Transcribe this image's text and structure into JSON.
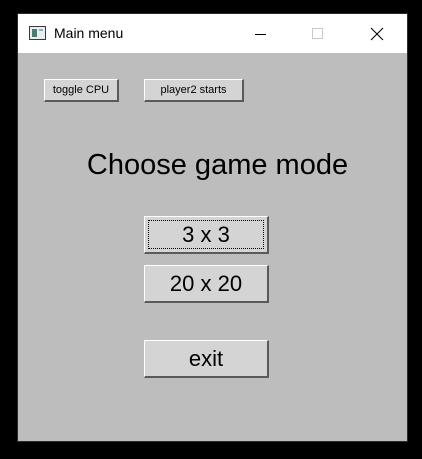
{
  "window": {
    "title": "Main menu",
    "icon": "window-app-icon",
    "controls": {
      "minimize_icon": "minimize-icon",
      "maximize_icon": "maximize-icon",
      "close_icon": "close-icon"
    }
  },
  "toolbar": {
    "toggle_cpu_label": "toggle CPU",
    "player2_starts_label": "player2 starts"
  },
  "main": {
    "heading": "Choose game mode",
    "modes": {
      "small_label": "3 x 3",
      "large_label": "20 x 20"
    },
    "exit_label": "exit"
  },
  "colors": {
    "window_background": "#bdbdbd",
    "titlebar_background": "#ffffff",
    "button_face": "#d4d4d4"
  }
}
